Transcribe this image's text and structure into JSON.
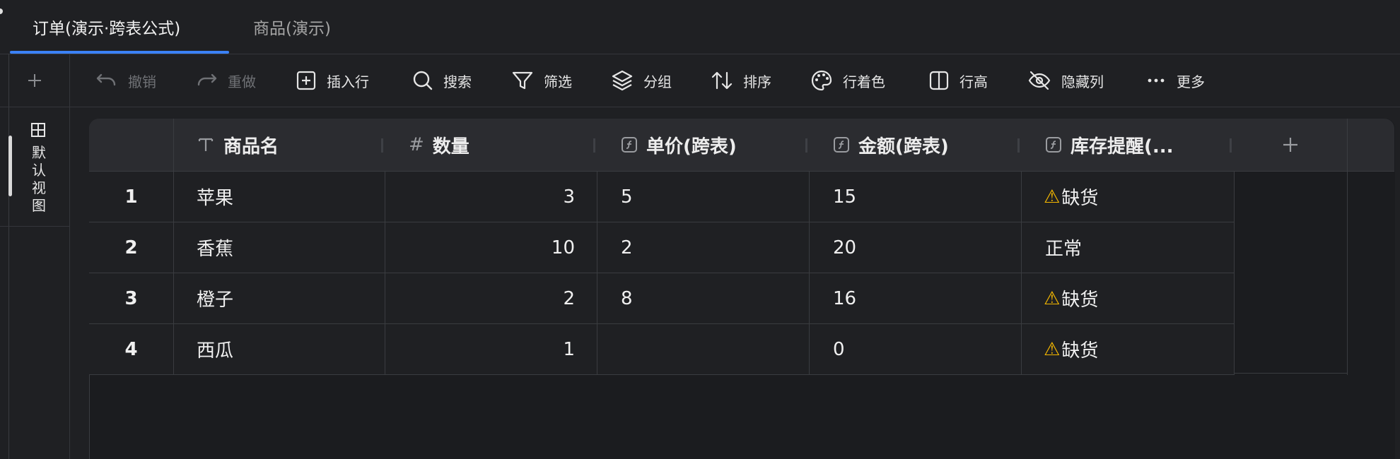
{
  "tabs": [
    {
      "label": "订单(演示·跨表公式)",
      "active": true
    },
    {
      "label": "商品(演示)",
      "active": false
    }
  ],
  "rail": {
    "add_icon": "plus-icon",
    "view_icon": "grid-icon",
    "view_label": "默认视图"
  },
  "toolbar": {
    "undo": "撤销",
    "redo": "重做",
    "insert_row": "插入行",
    "search": "搜索",
    "filter": "筛选",
    "group": "分组",
    "sort": "排序",
    "row_color": "行着色",
    "row_height": "行高",
    "hide_columns": "隐藏列",
    "more": "更多"
  },
  "columns": [
    {
      "label": "商品名",
      "type_icon": "text-type-icon"
    },
    {
      "label": "数量",
      "type_icon": "number-type-icon"
    },
    {
      "label": "单价(跨表)",
      "type_icon": "formula-type-icon"
    },
    {
      "label": "金额(跨表)",
      "type_icon": "formula-type-icon"
    },
    {
      "label": "库存提醒(...",
      "type_icon": "formula-type-icon"
    }
  ],
  "rows": [
    {
      "index": "1",
      "name": "苹果",
      "qty": "3",
      "price": "5",
      "amount": "15",
      "stock": "缺货",
      "warn": true
    },
    {
      "index": "2",
      "name": "香蕉",
      "qty": "10",
      "price": "2",
      "amount": "20",
      "stock": "正常",
      "warn": false
    },
    {
      "index": "3",
      "name": "橙子",
      "qty": "2",
      "price": "8",
      "amount": "16",
      "stock": "缺货",
      "warn": true
    },
    {
      "index": "4",
      "name": "西瓜",
      "qty": "1",
      "price": "",
      "amount": "0",
      "stock": "缺货",
      "warn": true
    }
  ],
  "warn_glyph": "⚠",
  "colors": {
    "accent": "#3b82f6",
    "warning": "#f5b800"
  }
}
